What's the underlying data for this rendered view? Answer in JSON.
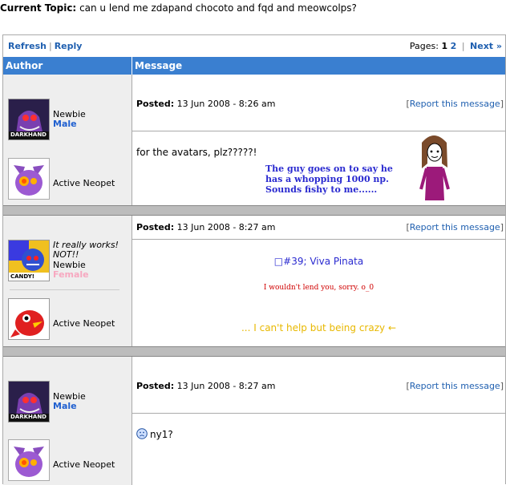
{
  "topic": {
    "label": "Current Topic:",
    "text": "can u lend me zdapand chocoto and fqd and meowcolps?"
  },
  "toolbar": {
    "refresh": "Refresh",
    "reply": "Reply",
    "pages_label": "Pages:",
    "page1": "1",
    "page2": "2",
    "next": "Next »"
  },
  "header": {
    "author": "Author",
    "message": "Message"
  },
  "posts": [
    {
      "avatar_label": "DARKHAND",
      "rank": "Newbie",
      "gender": "Male",
      "neopet_label": "Active Neopet",
      "posted_label": "Posted:",
      "posted_date": "13 Jun 2008 - 8:26 am",
      "report": "Report this message",
      "body": "for the avatars, plz?????!",
      "caption": "The guy goes on to say he has a whopping 1000 np. Sounds fishy to me......"
    },
    {
      "avatar_label": "CANDY!",
      "tagline": "It really works! NOT!!",
      "rank": "Newbie",
      "gender": "Female",
      "neopet_label": "Active Neopet",
      "posted_label": "Posted:",
      "posted_date": "13 Jun 2008 - 8:27 am",
      "report": "Report this message",
      "sig_title": "□#39; Viva Pinata",
      "body": "I wouldn't lend you, sorry. o_0",
      "sig_footer": "... I can't help but being crazy ←"
    },
    {
      "avatar_label": "DARKHAND",
      "rank": "Newbie",
      "gender": "Male",
      "neopet_label": "Active Neopet",
      "posted_label": "Posted:",
      "posted_date": "13 Jun 2008 - 8:27 am",
      "report": "Report this message",
      "body": "ny1?"
    }
  ],
  "colors": {
    "header_bg": "#3a7fd0",
    "link": "#2060b0",
    "male": "#2060d0",
    "female": "#f7a8c0",
    "sig_title": "#2a2ad0",
    "body_red": "#d00000",
    "sig_footer": "#e8b800"
  }
}
